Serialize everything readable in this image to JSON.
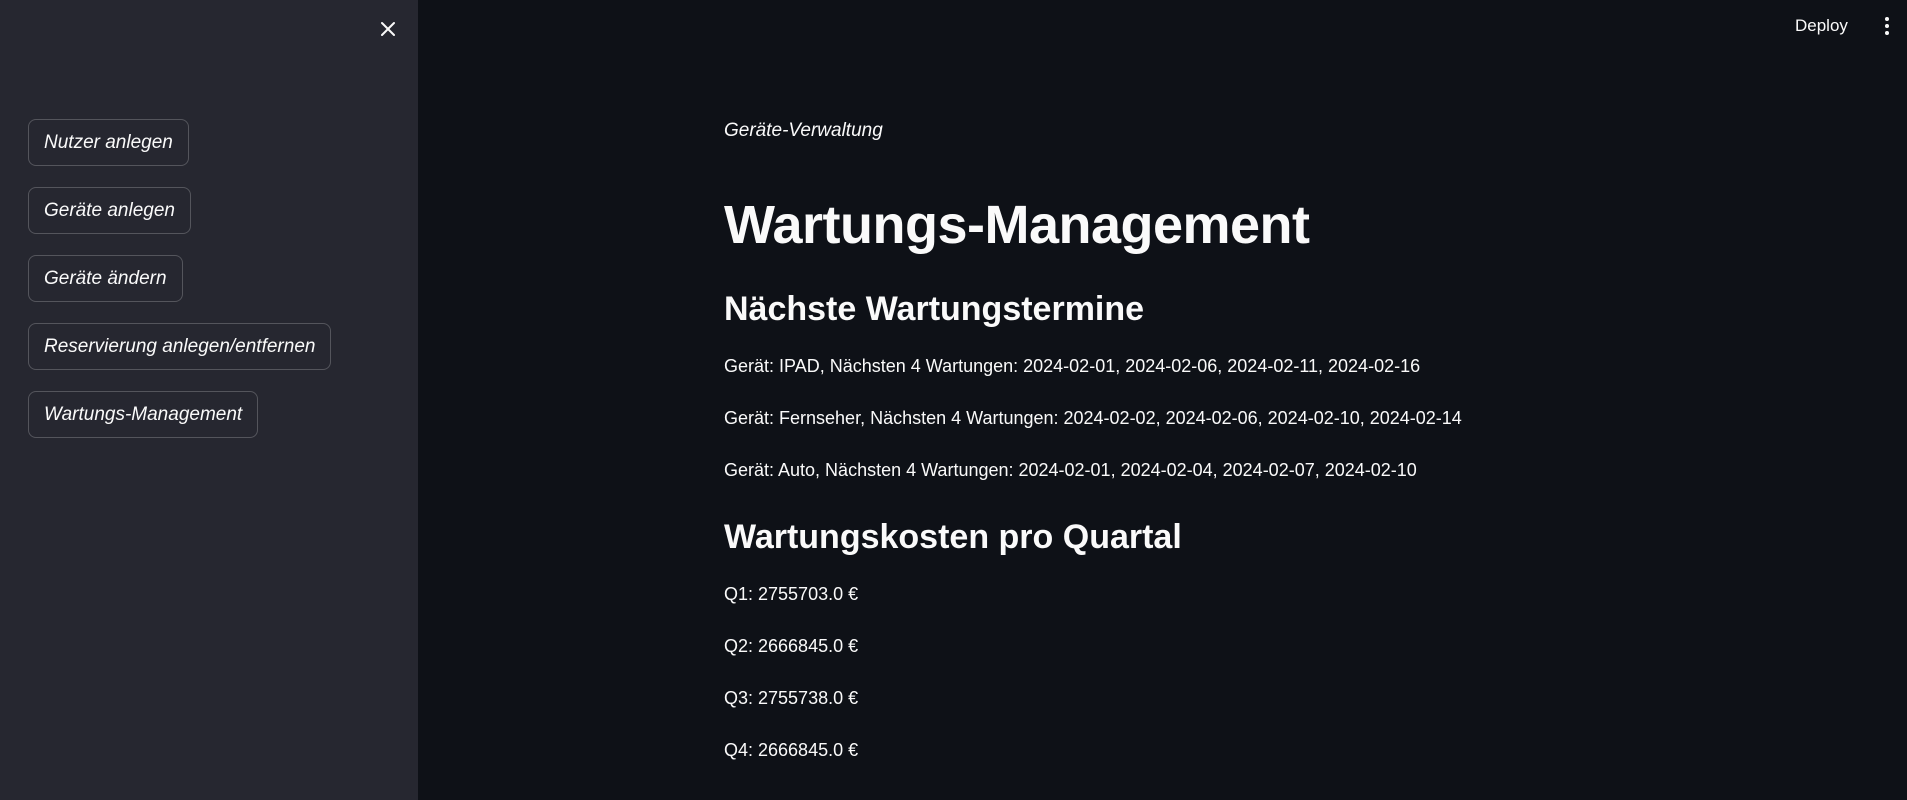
{
  "sidebar": {
    "close_icon": "close-icon",
    "items": [
      {
        "label": "Nutzer anlegen"
      },
      {
        "label": "Geräte anlegen"
      },
      {
        "label": "Geräte ändern"
      },
      {
        "label": "Reservierung anlegen/entfernen"
      },
      {
        "label": "Wartungs-Management"
      }
    ]
  },
  "toolbar": {
    "deploy_label": "Deploy",
    "menu_icon": "more-vertical-icon"
  },
  "main": {
    "caption": "Geräte-Verwaltung",
    "title": "Wartungs-Management",
    "section_termine": {
      "heading": "Nächste Wartungstermine",
      "lines": [
        "Gerät: IPAD, Nächsten 4 Wartungen: 2024-02-01, 2024-02-06, 2024-02-11, 2024-02-16",
        "Gerät: Fernseher, Nächsten 4 Wartungen: 2024-02-02, 2024-02-06, 2024-02-10, 2024-02-14",
        "Gerät: Auto, Nächsten 4 Wartungen: 2024-02-01, 2024-02-04, 2024-02-07, 2024-02-10"
      ]
    },
    "section_kosten": {
      "heading": "Wartungskosten pro Quartal",
      "lines": [
        "Q1: 2755703.0 €",
        "Q2: 2666845.0 €",
        "Q3: 2755738.0 €",
        "Q4: 2666845.0 €"
      ]
    }
  },
  "colors": {
    "main_bg": "#0e1117",
    "sidebar_bg": "#262730",
    "text": "#fafafa"
  }
}
